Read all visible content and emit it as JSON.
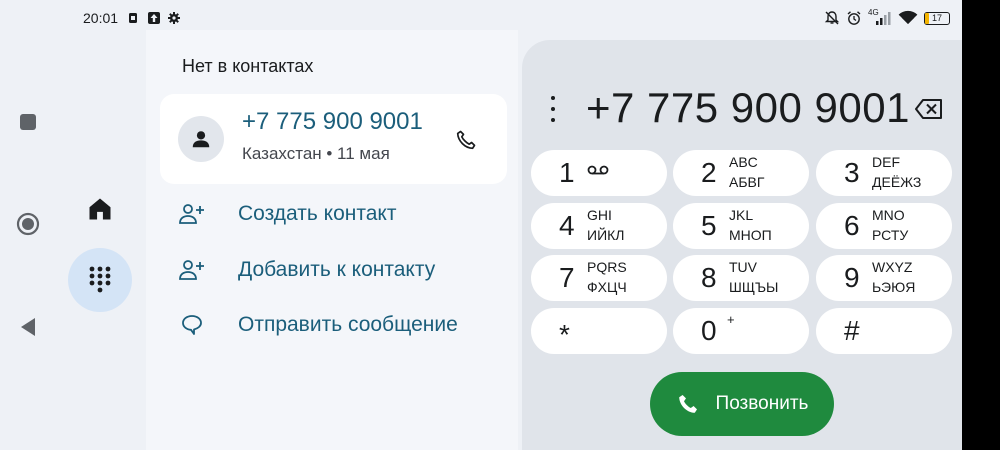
{
  "status_bar": {
    "time": "20:01",
    "network_label": "4G",
    "battery_level": "17"
  },
  "contact_panel": {
    "section_title": "Нет в контактах",
    "card": {
      "number": "+7 775 900 9001",
      "subtitle": "Казахстан • 11 мая"
    },
    "actions": [
      {
        "label": "Создать контакт",
        "icon": "person-add-icon"
      },
      {
        "label": "Добавить к контакту",
        "icon": "person-add-icon"
      },
      {
        "label": "Отправить сообщение",
        "icon": "message-icon"
      }
    ]
  },
  "dialer": {
    "number": "+7 775 900 9001",
    "keys": [
      {
        "digit": "1",
        "latin": "",
        "cyrillic": "",
        "extra": "voicemail-icon"
      },
      {
        "digit": "2",
        "latin": "ABC",
        "cyrillic": "АБВГ"
      },
      {
        "digit": "3",
        "latin": "DEF",
        "cyrillic": "ДЕЁЖЗ"
      },
      {
        "digit": "4",
        "latin": "GHI",
        "cyrillic": "ИЙКЛ"
      },
      {
        "digit": "5",
        "latin": "JKL",
        "cyrillic": "МНОП"
      },
      {
        "digit": "6",
        "latin": "MNO",
        "cyrillic": "РСТУ"
      },
      {
        "digit": "7",
        "latin": "PQRS",
        "cyrillic": "ФХЦЧ"
      },
      {
        "digit": "8",
        "latin": "TUV",
        "cyrillic": "ШЩЪЫ"
      },
      {
        "digit": "9",
        "latin": "WXYZ",
        "cyrillic": "ЬЭЮЯ"
      },
      {
        "digit": "*",
        "latin": "",
        "cyrillic": ""
      },
      {
        "digit": "0",
        "latin": "+",
        "cyrillic": ""
      },
      {
        "digit": "#",
        "latin": "",
        "cyrillic": ""
      }
    ],
    "call_label": "Позвонить"
  },
  "colors": {
    "accent_text": "#1b5e7b",
    "call_button": "#1f8a3e",
    "selected_rail": "#d4e4f6",
    "battery_low": "#f4b400"
  }
}
